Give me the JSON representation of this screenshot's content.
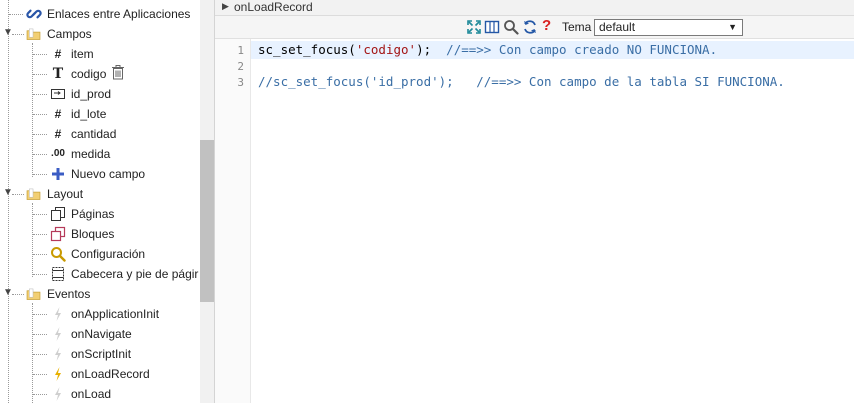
{
  "tree": {
    "items": [
      {
        "label": "Enlaces entre Aplicaciones",
        "icon": "link-icon"
      },
      {
        "label": "Campos",
        "icon": "folder-icon"
      },
      {
        "label": "item",
        "icon": "hash-icon"
      },
      {
        "label": "codigo",
        "icon": "text-type-icon"
      },
      {
        "label": "id_prod",
        "icon": "select-field-icon"
      },
      {
        "label": "id_lote",
        "icon": "hash-icon"
      },
      {
        "label": "cantidad",
        "icon": "hash-icon"
      },
      {
        "label": "medida",
        "icon": "decimal-icon"
      },
      {
        "label": "Nuevo campo",
        "icon": "plus-icon"
      },
      {
        "label": "Layout",
        "icon": "folder-icon"
      },
      {
        "label": "Páginas",
        "icon": "pages-icon"
      },
      {
        "label": "Bloques",
        "icon": "blocks-icon"
      },
      {
        "label": "Configuración",
        "icon": "magnifier-icon"
      },
      {
        "label": "Cabecera y pie de págir",
        "icon": "header-footer-icon"
      },
      {
        "label": "Eventos",
        "icon": "folder-icon"
      },
      {
        "label": "onApplicationInit",
        "icon": "lightning-icon"
      },
      {
        "label": "onNavigate",
        "icon": "lightning-icon"
      },
      {
        "label": "onScriptInit",
        "icon": "lightning-icon"
      },
      {
        "label": "onLoadRecord",
        "icon": "lightning-icon"
      },
      {
        "label": "onLoad",
        "icon": "lightning-icon"
      }
    ]
  },
  "panel": {
    "title": "onLoadRecord",
    "tema_label": "Tema",
    "tema_value": "default"
  },
  "editor": {
    "line_numbers": [
      "1",
      "2",
      "3"
    ],
    "line1_fn": "sc_set_focus(",
    "line1_str": "'codigo'",
    "line1_end": ");  ",
    "line1_comment": "//==>> Con campo creado NO FUNCIONA.",
    "line3_comment_a": "//sc_set_focus('id_prod');   ",
    "line3_comment_b": "//==>> Con campo de la tabla SI FUNCIONA."
  },
  "colors": {
    "accent_bolt": "#e8b100",
    "plus_blue": "#3b5cc4",
    "link_blue": "#2a56a8"
  }
}
